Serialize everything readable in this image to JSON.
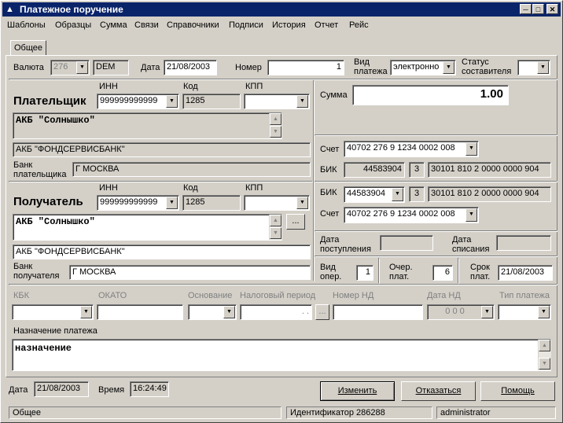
{
  "window": {
    "title": "Платежное поручение"
  },
  "menu": [
    "Шаблоны",
    "Образцы",
    "Сумма",
    "Связи",
    "Справочники",
    "Подписи",
    "История",
    "Отчет",
    "Рейс"
  ],
  "tab": {
    "label": "Общее"
  },
  "header": {
    "currency_label": "Валюта",
    "currency_code": "276",
    "currency_name": "DEM",
    "date_label": "Дата",
    "date_value": "21/08/2003",
    "number_label": "Номер",
    "number_value": "1",
    "payment_type_label": "Вид платежа",
    "payment_type_value": "электронно",
    "status_label": "Статус составителя",
    "status_value": ""
  },
  "payer": {
    "title": "Плательщик",
    "inn_label": "ИНН",
    "inn_value": "999999999999",
    "kod_label": "Код",
    "kod_value": "1285",
    "kpp_label": "КПП",
    "kpp_value": "",
    "name": "АКБ \"Солнышко\"",
    "bank_name": "АКБ \"ФОНДСЕРВИСБАНК\"",
    "bank_label": "Банк плательщика",
    "bank_city": "Г МОСКВА"
  },
  "receiver": {
    "title": "Получатель",
    "inn_label": "ИНН",
    "inn_value": "999999999999",
    "kod_label": "Код",
    "kod_value": "1285",
    "kpp_label": "КПП",
    "kpp_value": "",
    "name": "АКБ \"Солнышко\"",
    "bank_name": "АКБ \"ФОНДСЕРВИСБАНК\"",
    "bank_label": "Банк получателя",
    "bank_city": "Г МОСКВА",
    "ellipsis": "..."
  },
  "right": {
    "sum_label": "Сумма",
    "sum_value": "1.00",
    "account_label": "Счет",
    "payer_account": "40702 276 9 1234 0002 008",
    "bik_label": "БИК",
    "payer_bik": "44583904",
    "payer_bik_ext": "3",
    "payer_corr": "30101 810 2 0000 0000 904",
    "receiver_bik": "44583904",
    "receiver_bik_ext": "3",
    "receiver_corr": "30101 810 2 0000 0000 904",
    "receiver_account": "40702 276 9 1234 0002 008",
    "arrival_label": "Дата поступления",
    "writeoff_label": "Дата списания",
    "op_type_label": "Вид опер.",
    "op_type_value": "1",
    "queue_label": "Очер. плат.",
    "queue_value": "6",
    "due_label": "Срок плат.",
    "due_value": "21/08/2003"
  },
  "tax": {
    "kbk_label": "КБК",
    "okato_label": "ОКАТО",
    "basis_label": "Основание",
    "period_label": "Налоговый период",
    "period_value": ". .",
    "period_btn": "...",
    "doc_num_label": "Номер НД",
    "doc_date_label": "Дата НД",
    "doc_date_value": "0 0  0",
    "pay_type_label": "Тип платежа"
  },
  "purpose": {
    "label": "Назначение платежа",
    "value": "назначение"
  },
  "footer": {
    "date_label": "Дата",
    "date_value": "21/08/2003",
    "time_label": "Время",
    "time_value": "16:24:49",
    "change_button": "Изменить",
    "cancel_button": "Отказаться",
    "help_button": "Помощь"
  },
  "statusbar": {
    "left": "Общее",
    "middle": "Идентификатор 286288",
    "right": "administrator"
  }
}
